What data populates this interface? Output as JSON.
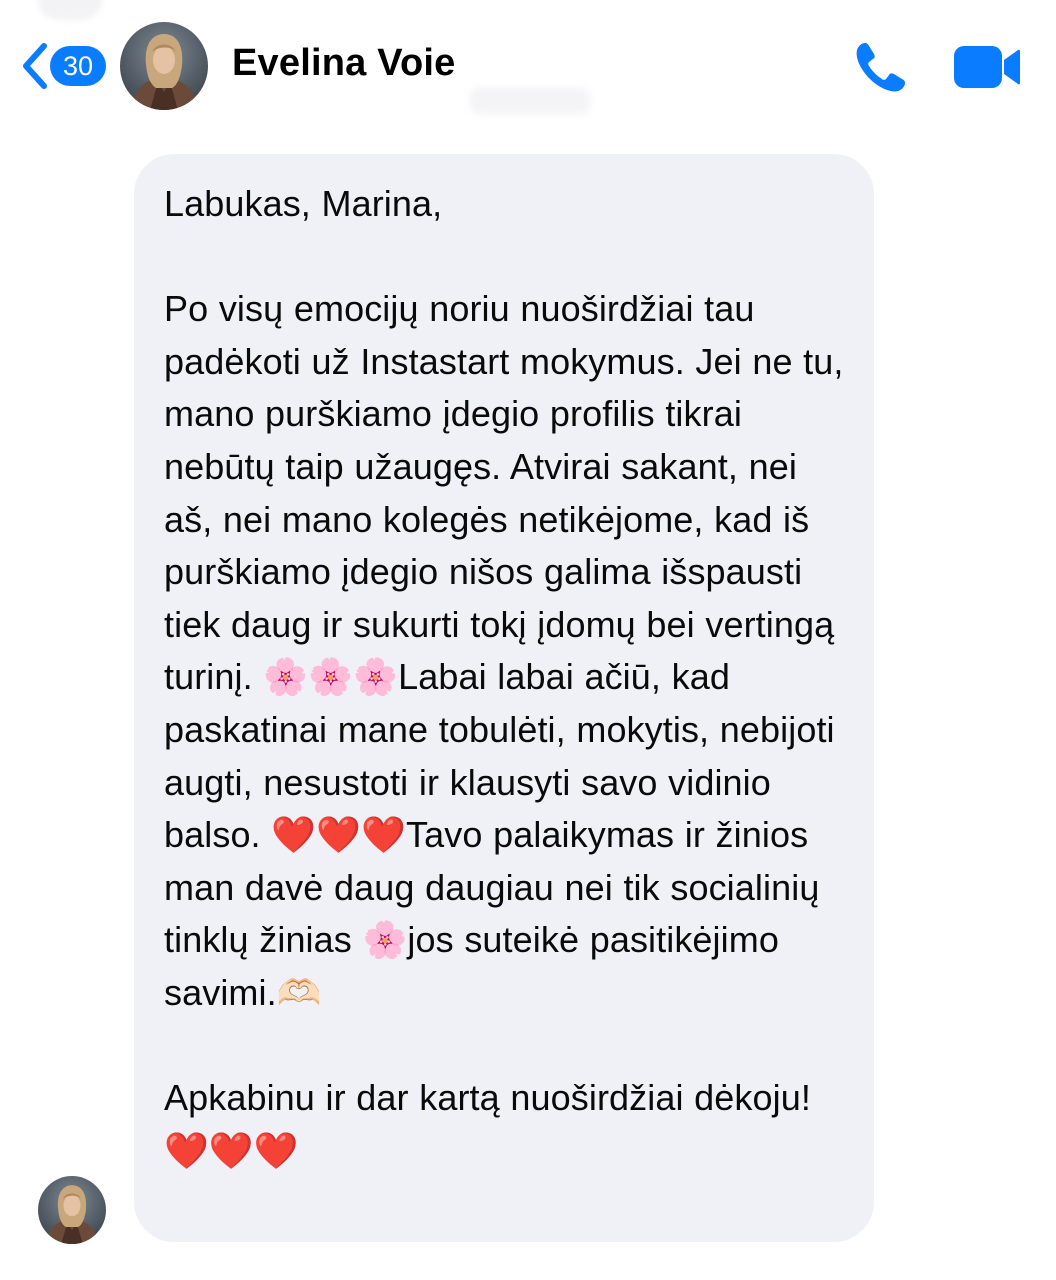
{
  "header": {
    "back_icon": "chevron-left-icon",
    "unread_count": "30",
    "contact_name": "Evelina Voie",
    "call_icon": "phone-icon",
    "video_icon": "video-camera-icon",
    "accent_color": "#0a7cff"
  },
  "message": {
    "bubble_color": "#f0f0f7",
    "text": "Labukas, Marina,\n\nPo visų emocijų noriu nuoširdžiai tau padėkoti už Instastart mokymus. Jei ne tu, mano purškiamo įdegio profilis tikrai nebūtų taip užaugęs. Atvirai sakant, nei aš, nei mano kolegės netikėjome, kad iš purškiamo įdegio nišos galima išspausti tiek daug ir sukurti tokį įdomų bei vertingą turinį. 🌸🌸🌸Labai labai ačiū, kad paskatinai mane tobulėti, mokytis, nebijoti augti, nesustoti ir klausyti savo vidinio balso. ❤️❤️❤️Tavo palaikymas ir žinios man davė daug daugiau nei tik socialinių tinklų žinias 🌸jos suteikė pasitikėjimo savimi.🫶🏻\n\nApkabinu ir dar kartą nuoširdžiai dėkoju! ❤️❤️❤️"
  }
}
